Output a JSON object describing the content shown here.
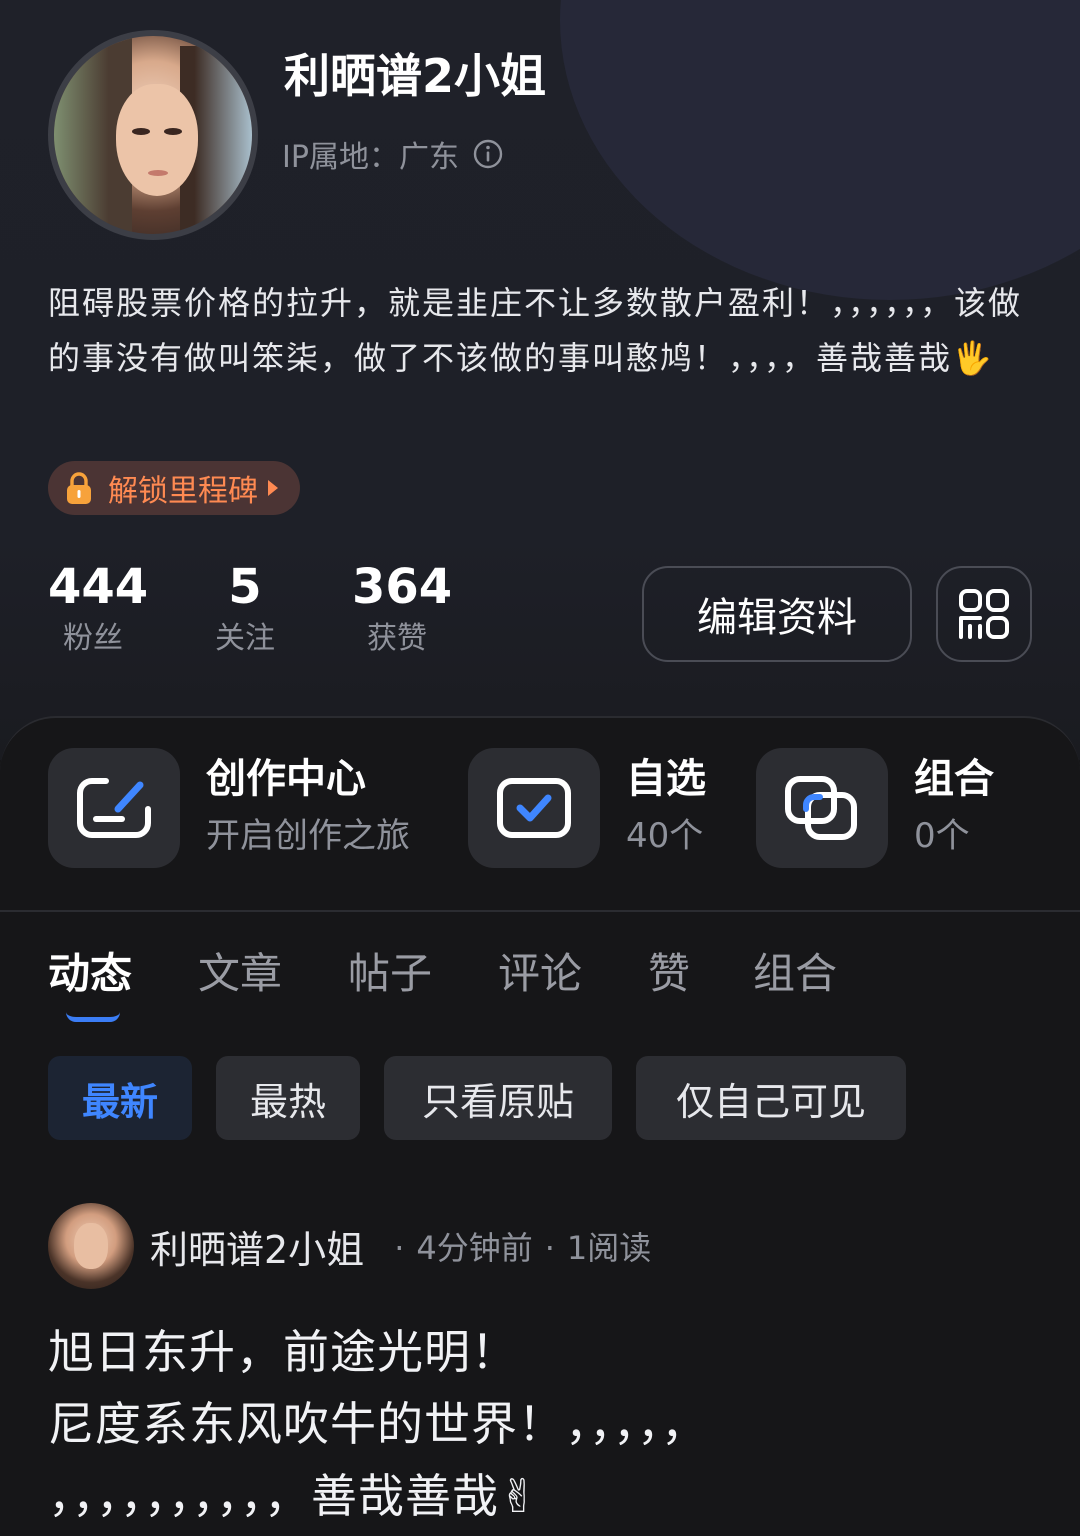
{
  "profile": {
    "name": "利晒谱2小姐",
    "ip_label": "IP属地：广东",
    "bio": "阻碍股票价格的拉升，就是韭庄不让多数散户盈利！，，，，，，该做的事没有做叫笨柒，做了不该做的事叫憨鸠！，，，，善哉善哉🖐",
    "milestone": "解锁里程碑",
    "stats": [
      {
        "value": "444",
        "label": "粉丝"
      },
      {
        "value": "5",
        "label": "关注"
      },
      {
        "value": "364",
        "label": "获赞"
      }
    ],
    "edit_button": "编辑资料"
  },
  "entries": [
    {
      "title": "创作中心",
      "subtitle": "开启创作之旅",
      "icon": "edit-icon"
    },
    {
      "title": "自选",
      "subtitle": "40个",
      "icon": "checkbox-icon"
    },
    {
      "title": "组合",
      "subtitle": "0个",
      "icon": "portfolio-icon"
    }
  ],
  "tabs": [
    "动态",
    "文章",
    "帖子",
    "评论",
    "赞",
    "组合"
  ],
  "active_tab": "动态",
  "filters": [
    "最新",
    "最热",
    "只看原贴",
    "仅自己可见"
  ],
  "active_filter": "最新",
  "post": {
    "author": "利晒谱2小姐",
    "time": "4分钟前",
    "reads": "1阅读",
    "body": "旭日东升，前途光明！\n尼度系东风吹牛的世界！，，，，，\n，，，，，，，，，，善哉善哉✌"
  },
  "colors": {
    "accent_blue": "#3f86ff",
    "milestone_orange": "#ff8a52",
    "background": "#161618"
  }
}
